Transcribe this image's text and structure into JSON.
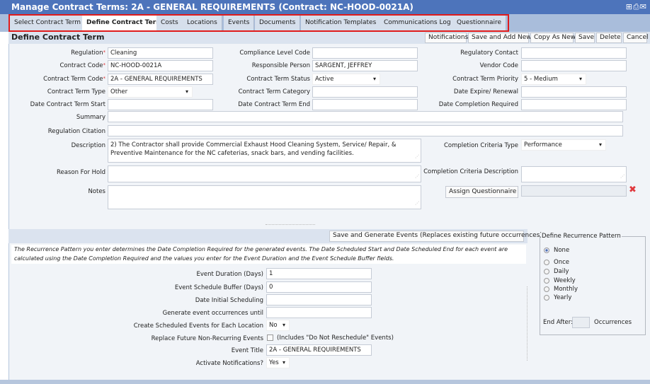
{
  "window": {
    "title": "Manage Contract Terms: 2A - GENERAL REQUIREMENTS (Contract: NC-HOOD-0021A)",
    "icons": [
      "add-icon",
      "print-icon",
      "email-icon"
    ]
  },
  "tabs": [
    "Select Contract Term",
    "Define Contract Term",
    "Costs",
    "Locations",
    "Events",
    "Documents",
    "Notification Templates",
    "Communications Log",
    "Questionnaire"
  ],
  "active_tab": "Define Contract Term",
  "section": {
    "title": "Define Contract Term",
    "buttons": [
      "Notifications",
      "Save and Add New",
      "Copy As New",
      "Save",
      "Delete",
      "Cancel"
    ]
  },
  "form": {
    "regulation": {
      "label": "Regulation",
      "value": "Cleaning"
    },
    "contract_code": {
      "label": "Contract Code",
      "value": "NC-HOOD-0021A"
    },
    "term_code": {
      "label": "Contract Term Code",
      "value": "2A  - GENERAL REQUIREMENTS"
    },
    "term_type": {
      "label": "Contract Term Type",
      "value": "Other"
    },
    "date_start": {
      "label": "Date Contract Term Start",
      "value": ""
    },
    "compliance": {
      "label": "Compliance Level Code",
      "value": ""
    },
    "responsible": {
      "label": "Responsible Person",
      "value": "SARGENT, JEFFREY"
    },
    "status": {
      "label": "Contract Term Status",
      "value": "Active"
    },
    "category": {
      "label": "Contract Term Category",
      "value": ""
    },
    "date_end": {
      "label": "Date Contract Term End",
      "value": ""
    },
    "reg_contact": {
      "label": "Regulatory Contact",
      "value": ""
    },
    "vendor": {
      "label": "Vendor Code",
      "value": ""
    },
    "priority": {
      "label": "Contract Term Priority",
      "value": "5 - Medium"
    },
    "expire": {
      "label": "Date Expire/ Renewal",
      "value": ""
    },
    "completion_req": {
      "label": "Date Completion Required",
      "value": ""
    },
    "summary": {
      "label": "Summary",
      "value": ""
    },
    "citation": {
      "label": "Regulation Citation",
      "value": ""
    },
    "description": {
      "label": "Description",
      "value": "2)     The Contractor shall provide Commercial Exhaust Hood Cleaning System, Service/ Repair, & Preventive Maintenance for the NC cafeterias, snack bars, and vending facilities."
    },
    "reason": {
      "label": "Reason For Hold",
      "value": ""
    },
    "notes": {
      "label": "Notes",
      "value": ""
    },
    "crit_type": {
      "label": "Completion Criteria Type",
      "value": "Performance"
    },
    "crit_desc": {
      "label": "Completion Criteria Description",
      "value": ""
    },
    "assign_q": "Assign Questionnaire",
    "required_mark": "*"
  },
  "events": {
    "save_generate": "Save and Generate Events (Replaces existing future occurrences)",
    "note": "The Recurrence Pattern you enter determines the Date Completion Required for the generated events. The Date Scheduled Start and Date Scheduled End for each event are calculated using the Date Completion Required and the values you enter for the Event Duration and the Event Schedule Buffer fields.",
    "duration": {
      "label": "Event Duration (Days)",
      "value": "1"
    },
    "buffer": {
      "label": "Event Schedule Buffer (Days)",
      "value": "0"
    },
    "initial": {
      "label": "Date Initial Scheduling",
      "value": ""
    },
    "until": {
      "label": "Generate event occurrences until",
      "value": ""
    },
    "each_loc": {
      "label": "Create Scheduled Events for Each Location",
      "value": "No"
    },
    "replace": {
      "label": "Replace Future Non-Recurring Events",
      "note": "(Includes \"Do Not Reschedule\" Events)",
      "checked": false
    },
    "title": {
      "label": "Event Title",
      "value": "2A  - GENERAL REQUIREMENTS"
    },
    "notify": {
      "label": "Activate Notifications?",
      "value": "Yes"
    }
  },
  "recurrence": {
    "legend": "Define Recurrence Pattern",
    "options": [
      "None",
      "Once",
      "Daily",
      "Weekly",
      "Monthly",
      "Yearly"
    ],
    "selected": "None",
    "end_after": "End After:",
    "end_value": "",
    "occurrences": "Occurrences"
  }
}
